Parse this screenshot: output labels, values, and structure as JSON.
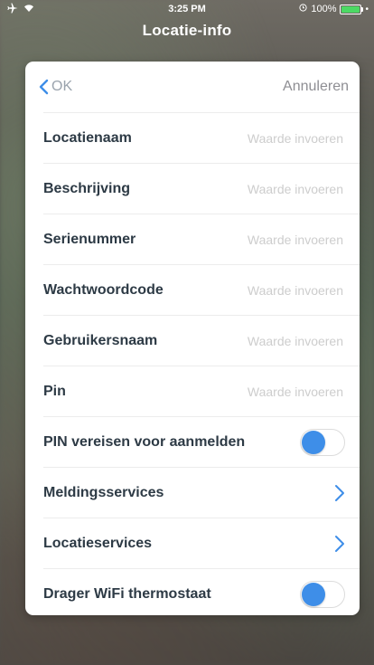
{
  "status_bar": {
    "time": "3:25 PM",
    "battery_text": "100%",
    "battery_level": 1.0,
    "left_icons": [
      "airplane-icon",
      "wifi-icon"
    ],
    "battery_color": "#4cd964"
  },
  "nav": {
    "title": "Locatie-info"
  },
  "card": {
    "back_label": "OK",
    "cancel_label": "Annuleren",
    "accent": "#3e8ee8"
  },
  "fields": [
    {
      "label": "Locatienaam",
      "placeholder": "Waarde invoeren",
      "value": ""
    },
    {
      "label": "Beschrijving",
      "placeholder": "Waarde invoeren",
      "value": ""
    },
    {
      "label": "Serienummer",
      "placeholder": "Waarde invoeren",
      "value": ""
    },
    {
      "label": "Wachtwoordcode",
      "placeholder": "Waarde invoeren",
      "value": ""
    },
    {
      "label": "Gebruikersnaam",
      "placeholder": "Waarde invoeren",
      "value": ""
    },
    {
      "label": "Pin",
      "placeholder": "Waarde invoeren",
      "value": ""
    }
  ],
  "toggles": {
    "pin_required": {
      "label": "PIN vereisen voor aanmelden",
      "on": false
    },
    "wifi_thermostat": {
      "label": "Drager WiFi thermostaat",
      "on": false
    }
  },
  "links": {
    "notification_services": {
      "label": "Meldingsservices",
      "icon": "chevron-right-icon"
    },
    "location_services": {
      "label": "Locatieservices",
      "icon": "chevron-right-icon"
    }
  }
}
